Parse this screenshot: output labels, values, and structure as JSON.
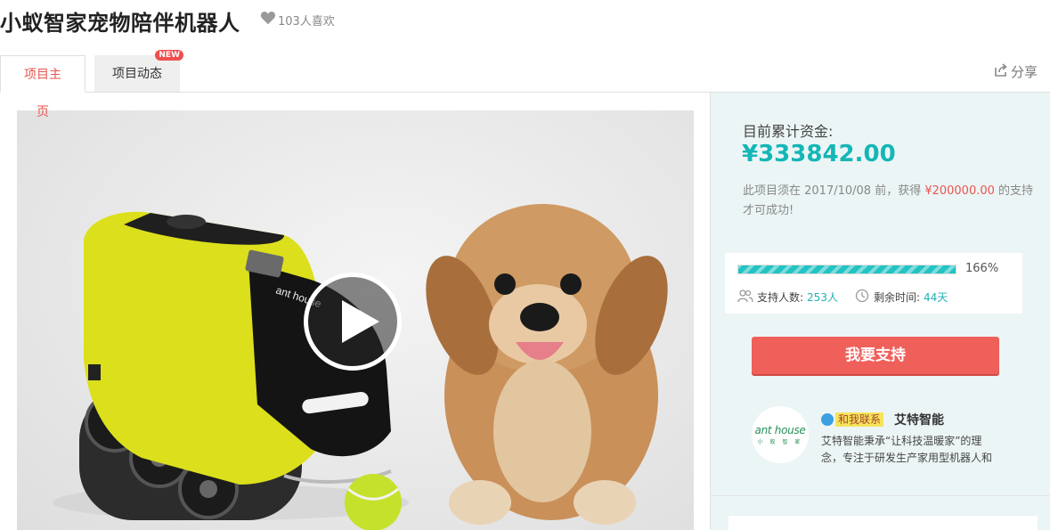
{
  "header": {
    "title": "小蚁智家宠物陪伴机器人",
    "likes": "103人喜欢"
  },
  "tabs": {
    "main": "项目主页",
    "news": "项目动态",
    "news_badge": "NEW",
    "share": "分享"
  },
  "hero": {
    "robot_brand": "ant house"
  },
  "funding": {
    "label": "目前累计资金:",
    "amount": "¥333842.00",
    "note_prefix": "此项目须在 2017/10/08 前，获得 ",
    "target": "¥200000.00",
    "note_suffix": " 的支持才可成功!",
    "progress_percent": 166,
    "progress_label": "166%",
    "supporters_label": "支持人数:",
    "supporters_value": "253人",
    "time_label": "剩余时间:",
    "time_value": "44天",
    "support_button": "我要支持"
  },
  "organizer": {
    "logo_text": "ant house",
    "logo_sub": "小 蚁 智 家",
    "contact_label": "和我联系",
    "name": "艾特智能",
    "description": "艾特智能秉承“让科技温暖家”的理念，专注于研发生产家用型机器人和"
  },
  "colors": {
    "accent_red": "#e8554e",
    "accent_teal": "#15b6b6",
    "button_red": "#f0605a",
    "panel_bg": "#ecf5f6"
  }
}
